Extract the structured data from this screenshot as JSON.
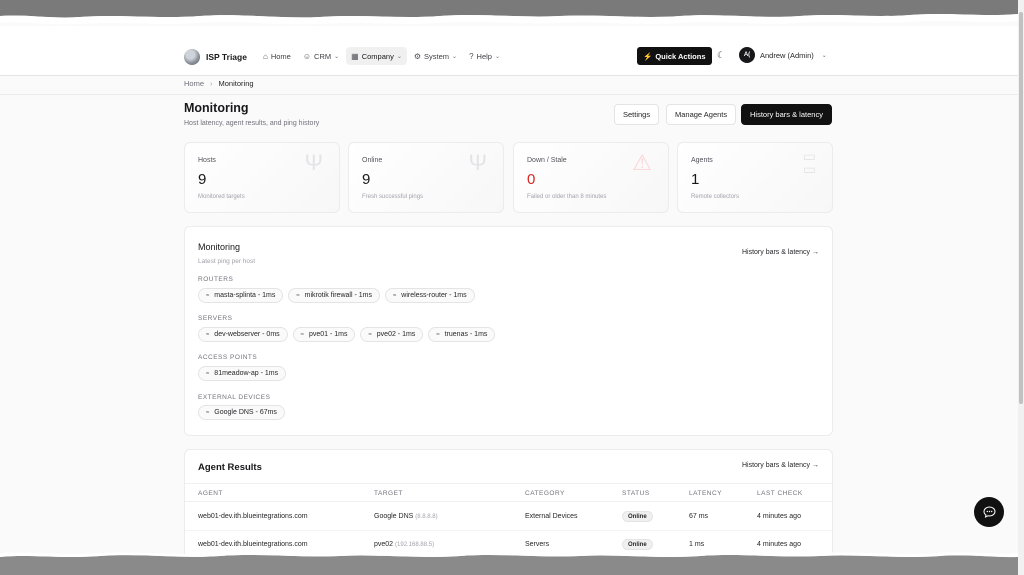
{
  "brand": {
    "name": "ISP Triage"
  },
  "nav": [
    {
      "label": "Home",
      "icon": "home-icon",
      "glyph": "⌂",
      "has_menu": false,
      "active": false
    },
    {
      "label": "CRM",
      "icon": "users-icon",
      "glyph": "☺",
      "has_menu": true,
      "active": false
    },
    {
      "label": "Company",
      "icon": "building-icon",
      "glyph": "▦",
      "has_menu": true,
      "active": true
    },
    {
      "label": "System",
      "icon": "gear-icon",
      "glyph": "⚙",
      "has_menu": true,
      "active": false
    },
    {
      "label": "Help",
      "icon": "help-icon",
      "glyph": "?",
      "has_menu": true,
      "active": false
    }
  ],
  "quick_actions": {
    "label": "Quick Actions"
  },
  "user": {
    "initials": "A(",
    "name": "Andrew (Admin)"
  },
  "breadcrumb": {
    "home": "Home",
    "current": "Monitoring"
  },
  "page": {
    "title": "Monitoring",
    "subtitle": "Host latency, agent results, and ping history",
    "buttons": {
      "settings": "Settings",
      "manage_agents": "Manage Agents",
      "history": "History bars & latency"
    }
  },
  "stats": [
    {
      "label": "Hosts",
      "value": "9",
      "desc": "Monitored targets",
      "icon": "antenna-icon"
    },
    {
      "label": "Online",
      "value": "9",
      "desc": "Fresh successful pings",
      "icon": "antenna-icon"
    },
    {
      "label": "Down / Stale",
      "value": "0",
      "desc": "Failed or older than 8 minutes",
      "icon": "warning-icon"
    },
    {
      "label": "Agents",
      "value": "1",
      "desc": "Remote collectors",
      "icon": "server-icon"
    }
  ],
  "monitoring": {
    "title": "Monitoring",
    "subtitle": "Latest ping per host",
    "link": "History bars & latency →",
    "groups": [
      {
        "label": "ROUTERS",
        "hosts": [
          "masta-splinta - 1ms",
          "mikrotik firewall - 1ms",
          "wireless-router - 1ms"
        ]
      },
      {
        "label": "SERVERS",
        "hosts": [
          "dev-webserver - 0ms",
          "pve01 - 1ms",
          "pve02 - 1ms",
          "truenas - 1ms"
        ]
      },
      {
        "label": "ACCESS POINTS",
        "hosts": [
          "81meadow-ap - 1ms"
        ]
      },
      {
        "label": "EXTERNAL DEVICES",
        "hosts": [
          "Google DNS - 67ms"
        ]
      }
    ]
  },
  "agent_results": {
    "title": "Agent Results",
    "link": "History bars & latency →",
    "columns": [
      "AGENT",
      "TARGET",
      "CATEGORY",
      "STATUS",
      "LATENCY",
      "LAST CHECK"
    ],
    "rows": [
      {
        "agent": "web01-dev.ith.blueintegrations.com",
        "target": "Google DNS",
        "ip": "(8.8.8.8)",
        "category": "External Devices",
        "status": "Online",
        "latency": "67 ms",
        "last_check": "4 minutes ago"
      },
      {
        "agent": "web01-dev.ith.blueintegrations.com",
        "target": "pve02",
        "ip": "(192.168.88.5)",
        "category": "Servers",
        "status": "Online",
        "latency": "1 ms",
        "last_check": "4 minutes ago"
      }
    ]
  }
}
